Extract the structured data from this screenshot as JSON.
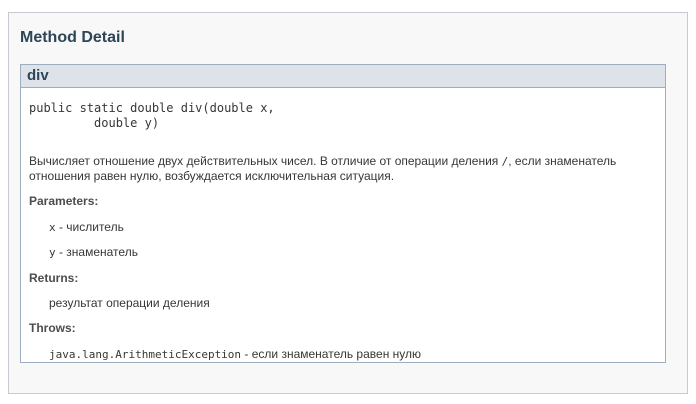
{
  "section_title": "Method Detail",
  "method": {
    "name": "div",
    "signature_line1": "public static double div(double x,",
    "signature_line2": "         double y)",
    "description_part1": "Вычисляет отношение двух действительных чисел. В отличие от операции деления ",
    "description_code": "/",
    "description_part2": ", если знаменатель отношения равен нулю, возбуждается исключительная ситуация.",
    "parameters_label": "Parameters:",
    "parameters": [
      {
        "name": "x",
        "desc": " - числитель"
      },
      {
        "name": "y",
        "desc": " - знаменатель"
      }
    ],
    "returns_label": "Returns:",
    "returns": "результат операции деления",
    "throws_label": "Throws:",
    "throws_exception": "java.lang.ArithmeticException",
    "throws_desc": " - если знаменатель равен нулю"
  }
}
